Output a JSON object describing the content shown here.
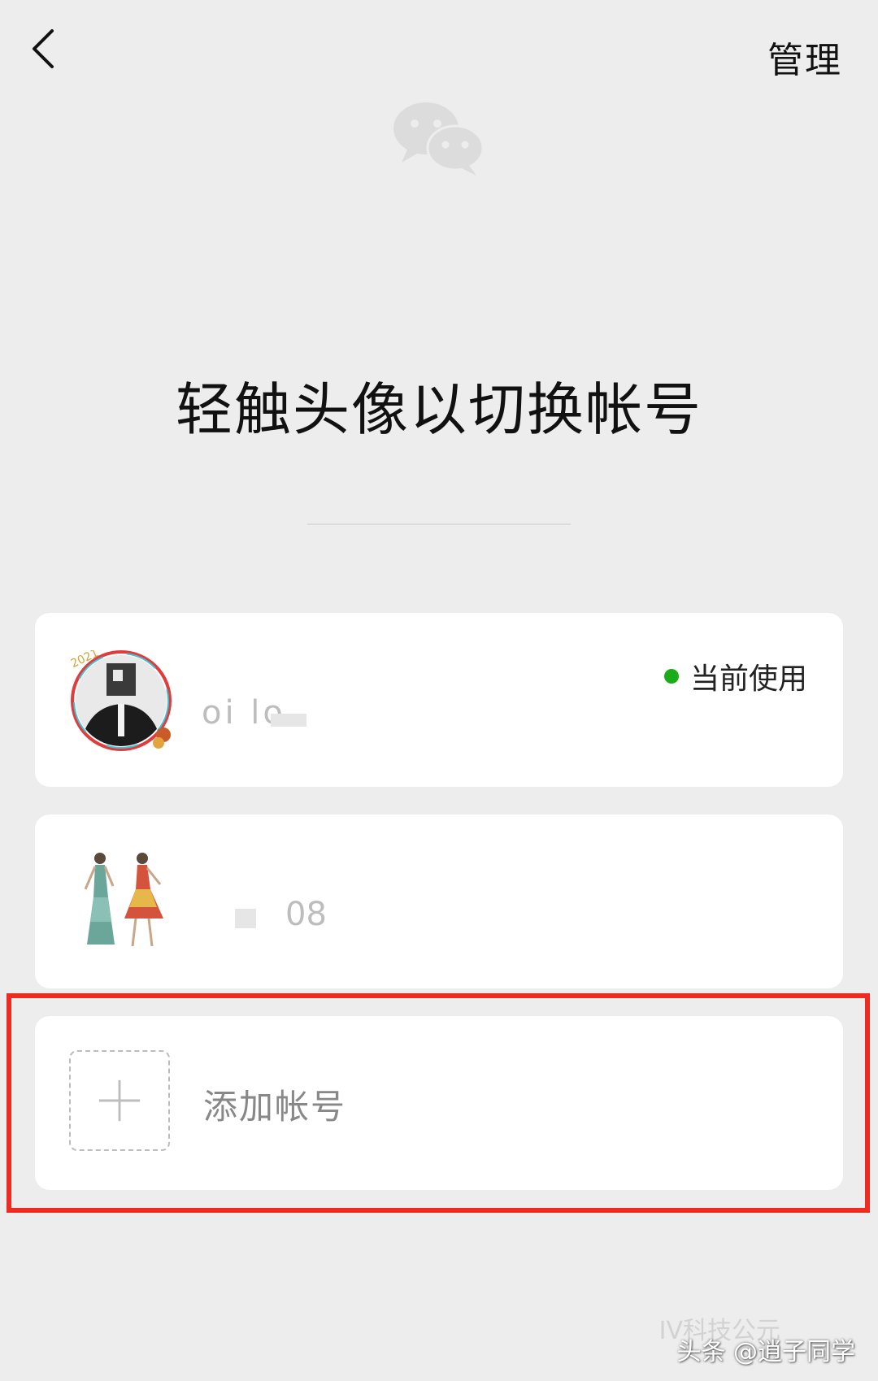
{
  "header": {
    "manage_label": "管理"
  },
  "main": {
    "title": "轻触头像以切换帐号"
  },
  "accounts": [
    {
      "name_partial": "oi lo",
      "status_label": "当前使用",
      "avatar_badge": "2021"
    },
    {
      "name_partial": "08"
    }
  ],
  "add_account": {
    "label": "添加帐号"
  },
  "watermark": {
    "faint_text": "IV科技公元",
    "text": "头条 @逍子同学"
  },
  "colors": {
    "background": "#ededed",
    "card": "#ffffff",
    "status_dot": "#1aad19",
    "highlight_border": "#ef2a20"
  }
}
